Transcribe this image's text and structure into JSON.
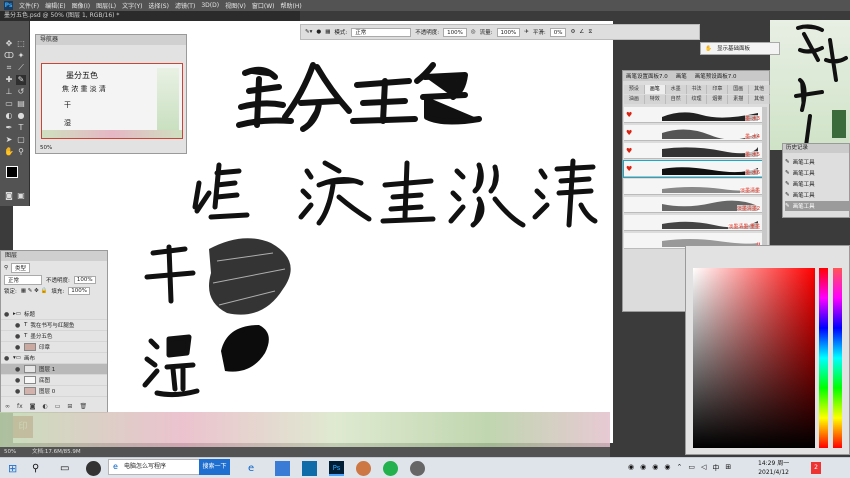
{
  "menu": {
    "items": [
      "文件(F)",
      "编辑(E)",
      "图像(I)",
      "图层(L)",
      "文字(Y)",
      "选择(S)",
      "滤镜(T)",
      "3D(D)",
      "视图(V)",
      "窗口(W)",
      "帮助(H)"
    ]
  },
  "document": {
    "tab_title": "墨分五色.psd @ 50% (图层 1, RGB/16) *"
  },
  "options_bar": {
    "mode_label": "模式:",
    "mode_value": "正常",
    "opacity_label": "不透明度:",
    "opacity_value": "100%",
    "flow_label": "流量:",
    "flow_value": "100%",
    "smooth_label": "平滑:",
    "smooth_value": "0%"
  },
  "navigator": {
    "title": "导航器",
    "zoom": "50%",
    "thumb_lines": [
      "墨分五色",
      "焦 浓 重 淡 清",
      "干",
      "湿"
    ]
  },
  "canvas": {
    "title_chars": "墨分五色",
    "row_chars": [
      "焦",
      "浓",
      "重",
      "淡",
      "清"
    ],
    "dry": "干",
    "wet": "湿"
  },
  "layers": {
    "title": "图层",
    "kind_label": "类型",
    "blend_mode": "正常",
    "opacity_label": "不透明度:",
    "opacity_value": "100%",
    "lock_label": "锁定:",
    "fill_label": "填充:",
    "fill_value": "100%",
    "rows": [
      {
        "name": "标题",
        "type": "group"
      },
      {
        "name": "我在书写与红腿鱼",
        "type": "text"
      },
      {
        "name": "墨分五色",
        "type": "text"
      },
      {
        "name": "印章",
        "type": "image"
      },
      {
        "name": "画布",
        "type": "group"
      },
      {
        "name": "图层 1",
        "type": "image",
        "selected": true
      },
      {
        "name": "底图",
        "type": "image"
      },
      {
        "name": "图层 0",
        "type": "image"
      }
    ]
  },
  "brush_panel": {
    "tabs": [
      "画笔设置面板7.0",
      "画笔",
      "画笔预设面板7.0"
    ],
    "tab_row1": [
      "预设",
      "画笔",
      "水墨",
      "书法",
      "印章",
      "国画",
      "其他"
    ],
    "tab_row2": [
      "油画",
      "特效",
      "自然",
      "纹理",
      "烟雾",
      "素描",
      "其他"
    ],
    "items": [
      {
        "label": "墨-水3"
      },
      {
        "label": "墨-水4"
      },
      {
        "label": "墨-水5"
      },
      {
        "label": "墨-水6",
        "selected": true
      },
      {
        "label": "淡墨清墨"
      },
      {
        "label": "淡墨清墨2"
      },
      {
        "label": "淡墨清墨-重墨"
      },
      {
        "label": "T"
      }
    ]
  },
  "history": {
    "title": "历史记录",
    "rows": [
      "画笔工具",
      "画笔工具",
      "画笔工具",
      "画笔工具",
      "画笔工具"
    ],
    "selected_index": 4
  },
  "tooltip": {
    "text": "显示基础面板"
  },
  "status": {
    "zoom": "50%",
    "doc": "文档:17.6M/85.9M"
  },
  "taskbar": {
    "search_text": "电脑怎么写程序",
    "search_button": "搜索一下",
    "time": "14:29",
    "weekday": "周一",
    "date": "2021/4/12",
    "ime": "中",
    "notifications": "2"
  },
  "colors": {
    "accent": "#19a8c8",
    "brush_label_red": "#d21",
    "ink": "#111111",
    "taskbar_blue": "#1f6fd1"
  }
}
